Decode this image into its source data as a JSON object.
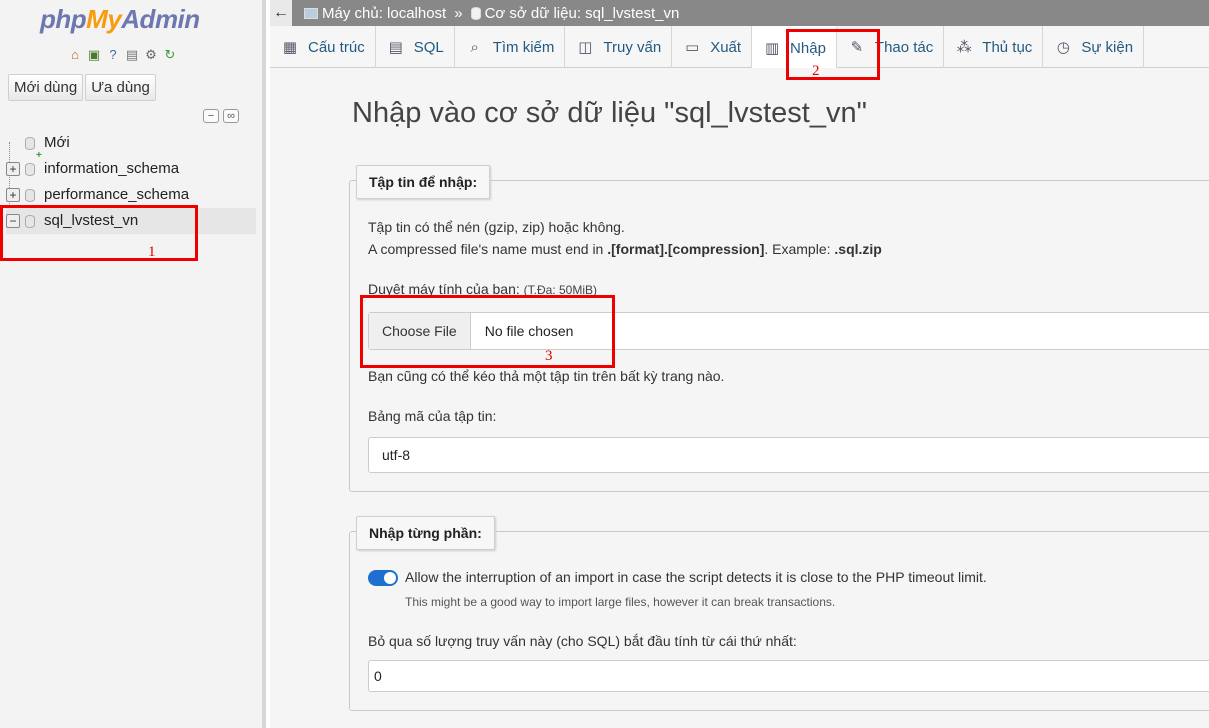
{
  "nav": {
    "logo": {
      "php": "php",
      "my": "My",
      "admin": "Admin"
    },
    "icons": [
      "home-icon",
      "exit-icon",
      "help-icon",
      "docs-icon",
      "settings-icon",
      "reload-icon"
    ],
    "tabs": [
      {
        "label": "Mới dùng"
      },
      {
        "label": "Ưa dùng"
      }
    ],
    "tree": [
      {
        "label": "Mới"
      },
      {
        "label": "information_schema"
      },
      {
        "label": "performance_schema"
      },
      {
        "label": "sql_lvstest_vn"
      }
    ]
  },
  "breadcrumb": {
    "server": "Máy chủ: localhost",
    "separator": "»",
    "database": "Cơ sở dữ liệu: sql_lvstest_vn"
  },
  "tabs": [
    {
      "label": "Cấu trúc",
      "icon": "structure-icon"
    },
    {
      "label": "SQL",
      "icon": "sql-icon"
    },
    {
      "label": "Tìm kiếm",
      "icon": "search-icon"
    },
    {
      "label": "Truy vấn",
      "icon": "query-icon"
    },
    {
      "label": "Xuất",
      "icon": "export-icon"
    },
    {
      "label": "Nhập",
      "icon": "import-icon"
    },
    {
      "label": "Thao tác",
      "icon": "wrench-icon"
    },
    {
      "label": "Thủ tục",
      "icon": "routines-icon"
    },
    {
      "label": "Sự kiện",
      "icon": "events-icon"
    }
  ],
  "main": {
    "title": "Nhập vào cơ sở dữ liệu \"sql_lvstest_vn\"",
    "file_section": {
      "legend": "Tập tin để nhập:",
      "compress_note": "Tập tin có thể nén (gzip, zip) hoặc không.",
      "name_note_prefix": "A compressed file's name must end in ",
      "name_note_format": ".[format].[compression]",
      "name_note_mid": ". Example: ",
      "name_note_example": ".sql.zip",
      "browse_label": "Duyệt máy tính của bạn:",
      "max_size": "(T.Đa: 50MiB)",
      "choose_file_button": "Choose File",
      "no_file": "No file chosen",
      "drag_note": "Bạn cũng có thể kéo thả một tập tin trên bất kỳ trang nào.",
      "charset_label": "Bảng mã của tập tin:",
      "charset_value": "utf-8"
    },
    "partial_section": {
      "legend": "Nhập từng phần:",
      "allow_interrupt": "Allow the interruption of an import in case the script detects it is close to the PHP timeout limit.",
      "allow_interrupt_hint": "This might be a good way to import large files, however it can break transactions.",
      "skip_label": "Bỏ qua số lượng truy vấn này (cho SQL) bắt đầu tính từ cái thứ nhất:",
      "skip_value": "0"
    }
  },
  "annotations": [
    "1",
    "2",
    "3"
  ],
  "colors": {
    "annotation": "#ee0000",
    "link": "#235a81",
    "toggle": "#1f6fd1"
  }
}
